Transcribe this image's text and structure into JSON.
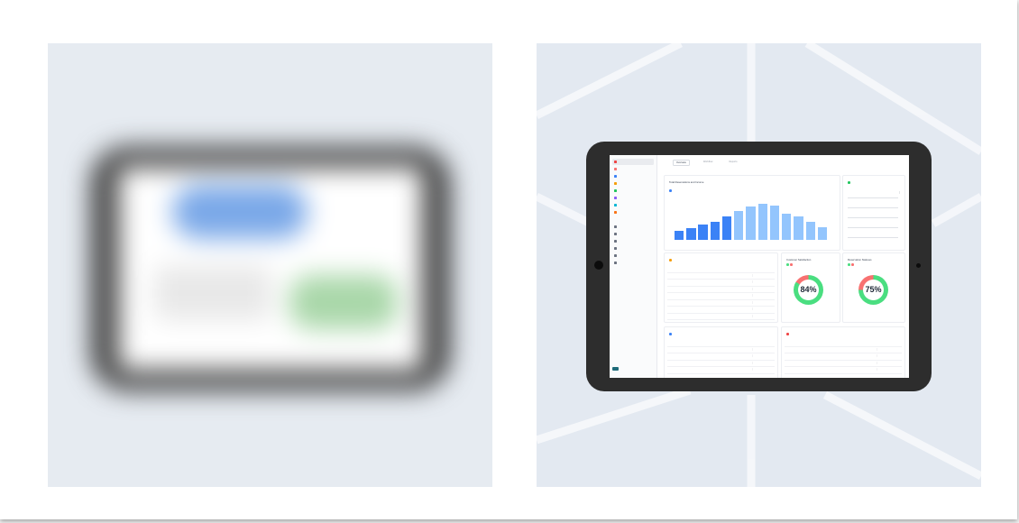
{
  "colors": {
    "bar_dark": "#3b82f6",
    "bar_light": "#93c5fd",
    "donut_green": "#4ade80",
    "donut_red": "#f87171"
  },
  "dashboard": {
    "tabs": [
      {
        "label": "Overview"
      },
      {
        "label": "Workflow"
      },
      {
        "label": "Reports"
      }
    ],
    "reservations_chart": {
      "title": "Total Reservations and Income"
    },
    "customer_satisfaction": {
      "title": "Customer Satisfaction",
      "value": "84%"
    },
    "reservation_statuses": {
      "title": "Reservation Statuses",
      "value": "75%"
    }
  },
  "chart_data": {
    "type": "bar",
    "title": "Total Reservations and Income",
    "values": [
      10,
      13,
      17,
      21,
      27,
      33,
      38,
      41,
      39,
      30,
      27,
      21,
      14
    ]
  }
}
